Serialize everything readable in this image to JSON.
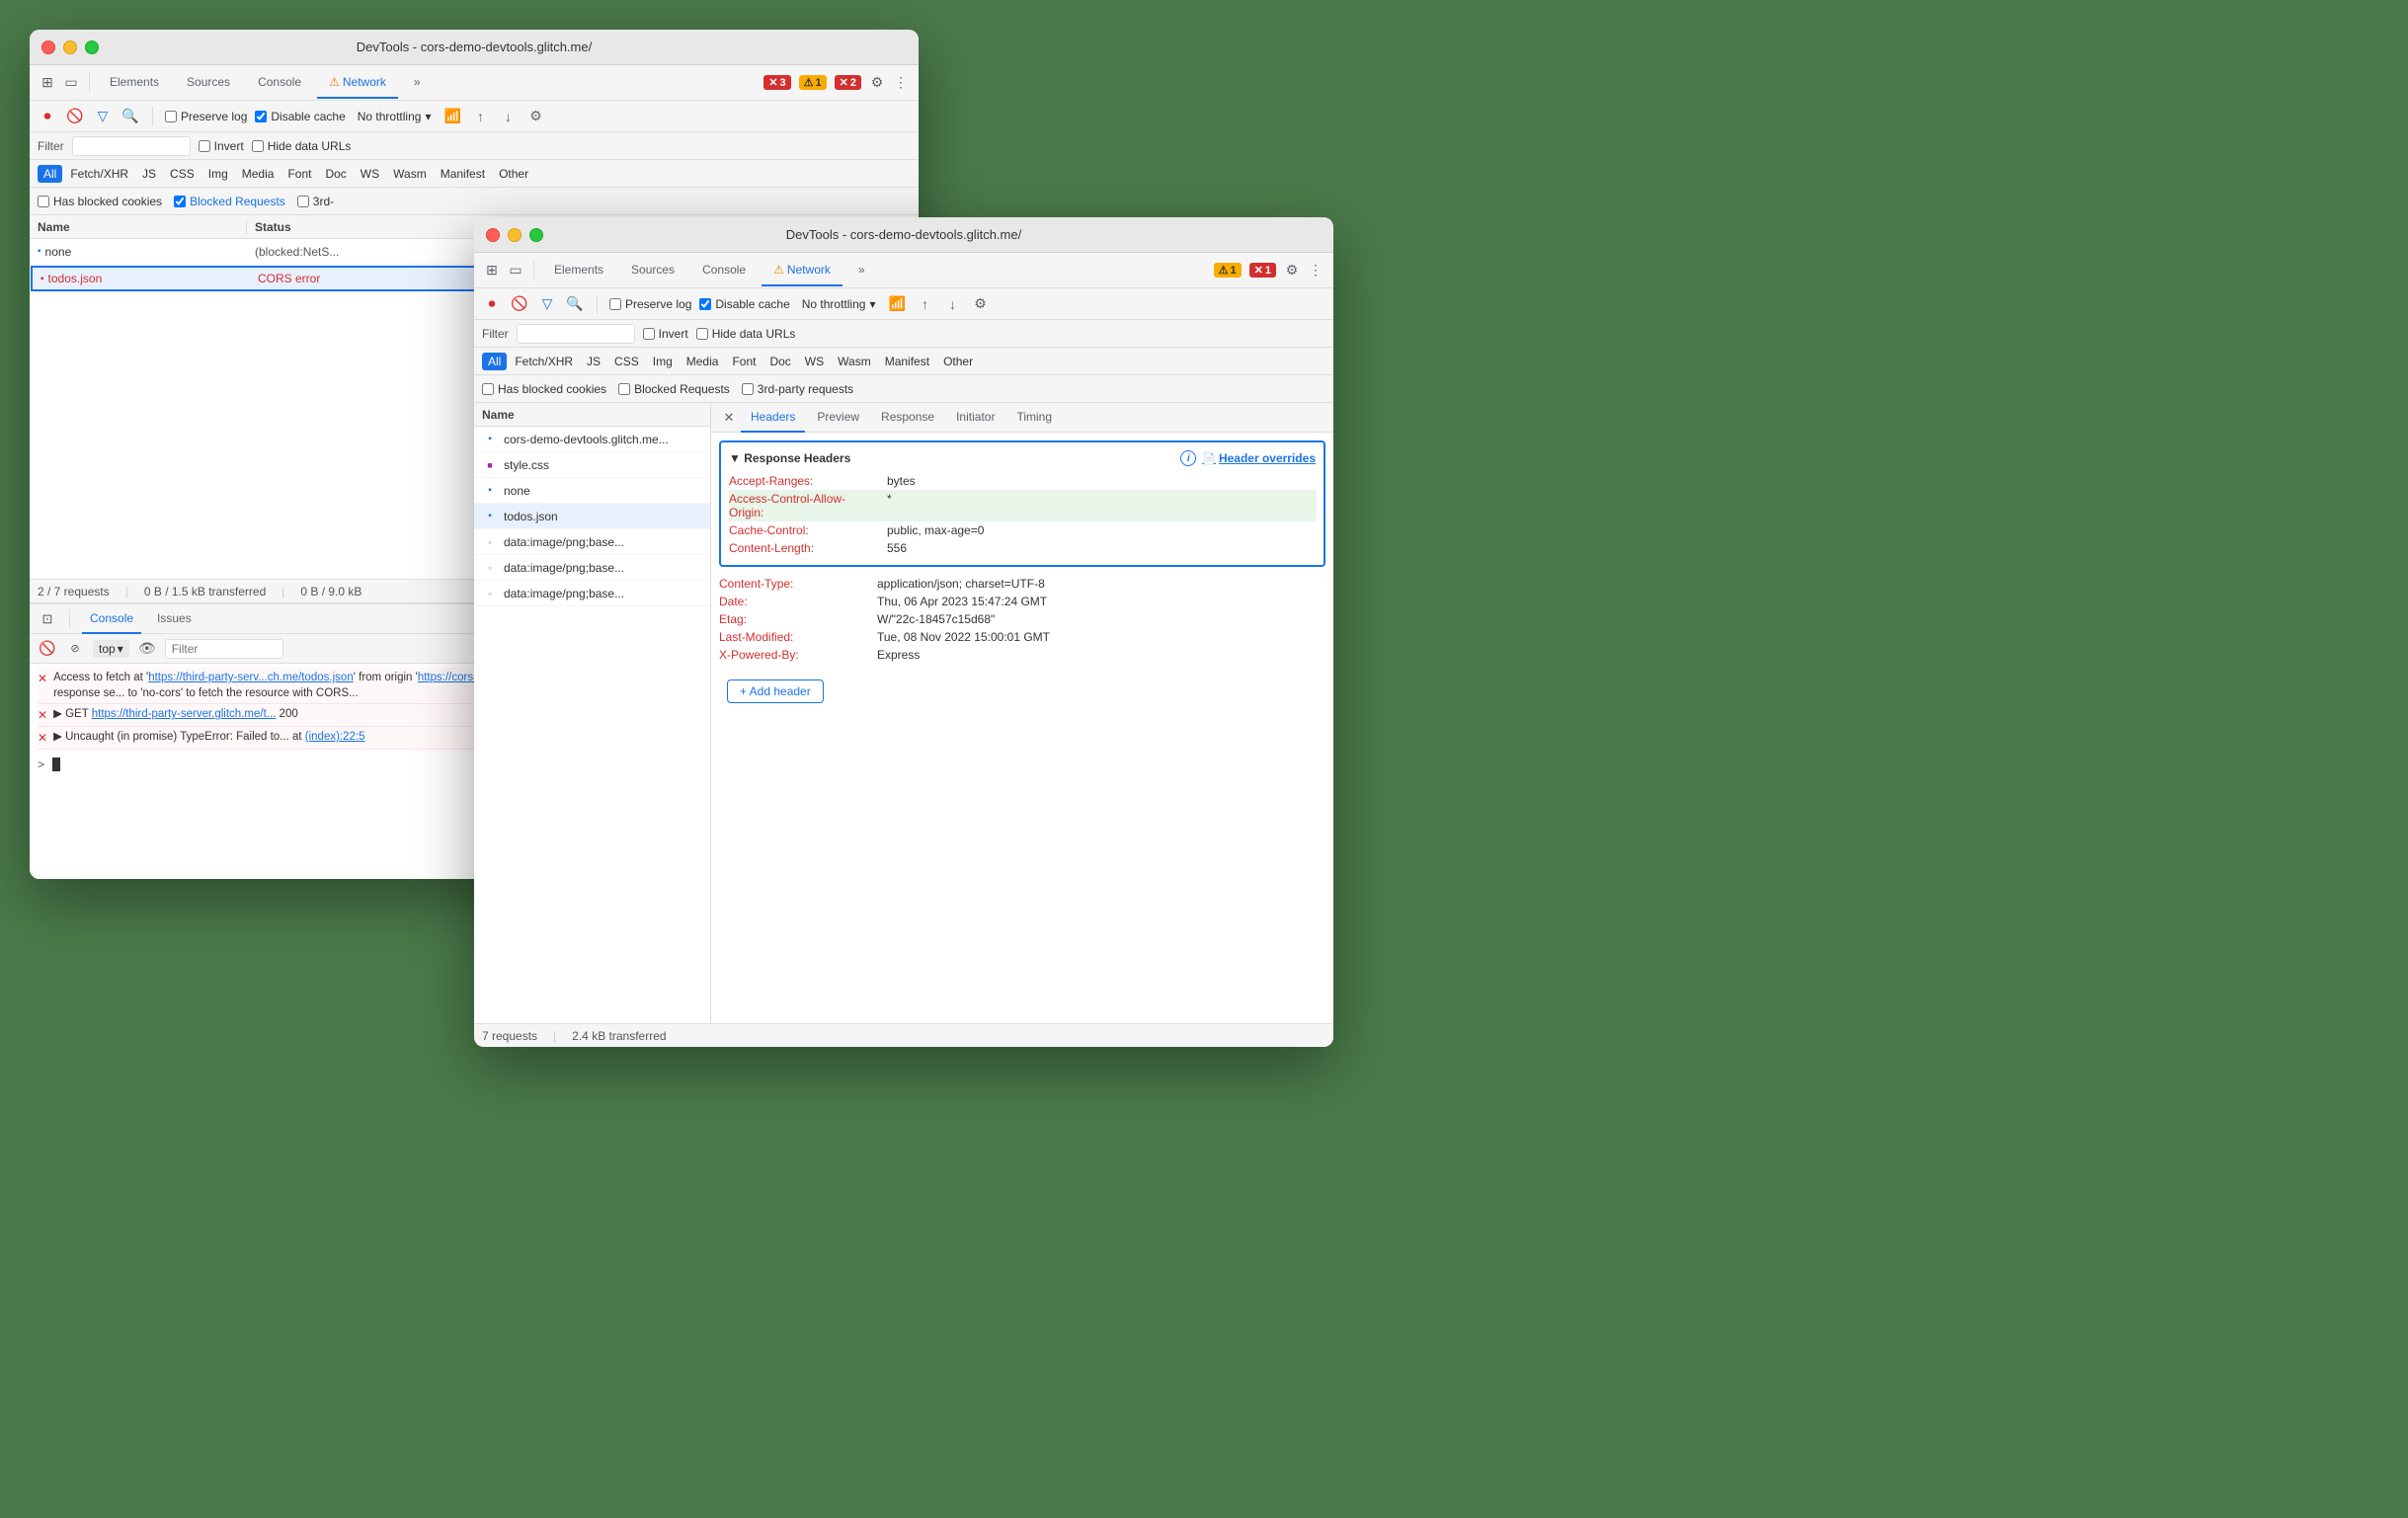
{
  "window1": {
    "title": "DevTools - cors-demo-devtools.glitch.me/",
    "tabs": [
      "Elements",
      "Sources",
      "Console",
      "Network",
      "⋮"
    ],
    "activeTab": "Network",
    "networkToolbar": {
      "preserveLog": "Preserve log",
      "disableCache": "Disable cache",
      "throttle": "No throttling",
      "filterPlaceholder": "Filter",
      "invert": "Invert",
      "hideDataUrls": "Hide data URLs"
    },
    "typeFilters": [
      "All",
      "Fetch/XHR",
      "JS",
      "CSS",
      "Img",
      "Media",
      "Font",
      "Doc",
      "WS",
      "Wasm",
      "Manifest",
      "Other"
    ],
    "activeTypeFilter": "All",
    "blockedBar": {
      "hasCookies": "Has blocked cookies",
      "blockedRequests": "Blocked Requests",
      "thirdParty": "3rd-"
    },
    "tableHeaders": [
      "Name",
      "Status"
    ],
    "tableRows": [
      {
        "name": "none",
        "status": "(blocked:NetS..."
      },
      {
        "name": "todos.json",
        "status": "CORS error",
        "error": true,
        "selected": true
      }
    ],
    "statusBar": {
      "requests": "2 / 7 requests",
      "transferred": "0 B / 1.5 kB transferred",
      "size": "0 B / 9.0 kB"
    },
    "badges": {
      "errors": "3",
      "warnings": "1",
      "info": "2"
    },
    "consoleTabs": [
      "Console",
      "Issues"
    ],
    "activeConsoleTab": "Console",
    "consoleToolbar": {
      "top": "top",
      "filterPlaceholder": "Filter"
    },
    "consoleEntries": [
      {
        "type": "error",
        "text": "Access to fetch at 'https://third-party-serv...ch.me/todos.json' from origin 'https://cors-...' blocked by CORS policy: No 'Access-Control-A... requested resource. If an opaque response se... to 'no-cors' to fetch the resource with CORS..."
      },
      {
        "type": "error",
        "text": "▶ GET https://third-party-server.glitch.me/t... 200"
      },
      {
        "type": "error",
        "text": "▶ Uncaught (in promise) TypeError: Failed to... at (index):22:5"
      }
    ]
  },
  "window2": {
    "title": "DevTools - cors-demo-devtools.glitch.me/",
    "tabs": [
      "Elements",
      "Sources",
      "Console",
      "Network",
      "⋮"
    ],
    "activeTab": "Network",
    "networkToolbar": {
      "preserveLog": "Preserve log",
      "disableCache": "Disable cache",
      "throttle": "No throttling"
    },
    "typeFilters": [
      "All",
      "Fetch/XHR",
      "JS",
      "CSS",
      "Img",
      "Media",
      "Font",
      "Doc",
      "WS",
      "Wasm",
      "Manifest",
      "Other"
    ],
    "activeTypeFilter": "All",
    "blockedBar": {
      "hasCookies": "Has blocked cookies",
      "blockedRequests": "Blocked Requests",
      "thirdParty": "3rd-party requests"
    },
    "fileList": {
      "header": "Name",
      "items": [
        {
          "name": "cors-demo-devtools.glitch.me...",
          "type": "doc"
        },
        {
          "name": "style.css",
          "type": "css"
        },
        {
          "name": "none",
          "type": "doc"
        },
        {
          "name": "todos.json",
          "type": "doc",
          "selected": true
        },
        {
          "name": "data:image/png;base...",
          "type": "img"
        },
        {
          "name": "data:image/png;base...",
          "type": "img"
        },
        {
          "name": "data:image/png;base...",
          "type": "img"
        }
      ]
    },
    "headersTabs": [
      "Headers",
      "Preview",
      "Response",
      "Initiator",
      "Timing"
    ],
    "activeHeadersTab": "Headers",
    "responseHeaders": {
      "title": "▼ Response Headers",
      "overridesLink": "Header overrides",
      "headers": [
        {
          "name": "Accept-Ranges:",
          "value": "bytes",
          "highlighted": false
        },
        {
          "name": "Access-Control-Allow-Origin:",
          "value": "*",
          "highlighted": true
        },
        {
          "name": "Cache-Control:",
          "value": "public, max-age=0",
          "highlighted": false
        },
        {
          "name": "Content-Length:",
          "value": "556",
          "highlighted": false
        },
        {
          "name": "Content-Type:",
          "value": "application/json; charset=UTF-8",
          "highlighted": false
        },
        {
          "name": "Date:",
          "value": "Thu, 06 Apr 2023 15:47:24 GMT",
          "highlighted": false
        },
        {
          "name": "Etag:",
          "value": "W/\"22c-18457c15d68\"",
          "highlighted": false
        },
        {
          "name": "Last-Modified:",
          "value": "Tue, 08 Nov 2022 15:00:01 GMT",
          "highlighted": false
        },
        {
          "name": "X-Powered-By:",
          "value": "Express",
          "highlighted": false
        }
      ]
    },
    "addHeader": "+ Add header",
    "statusBar": {
      "requests": "7 requests",
      "transferred": "2.4 kB transferred"
    },
    "badges": {
      "warnings": "1",
      "errors": "1"
    }
  }
}
